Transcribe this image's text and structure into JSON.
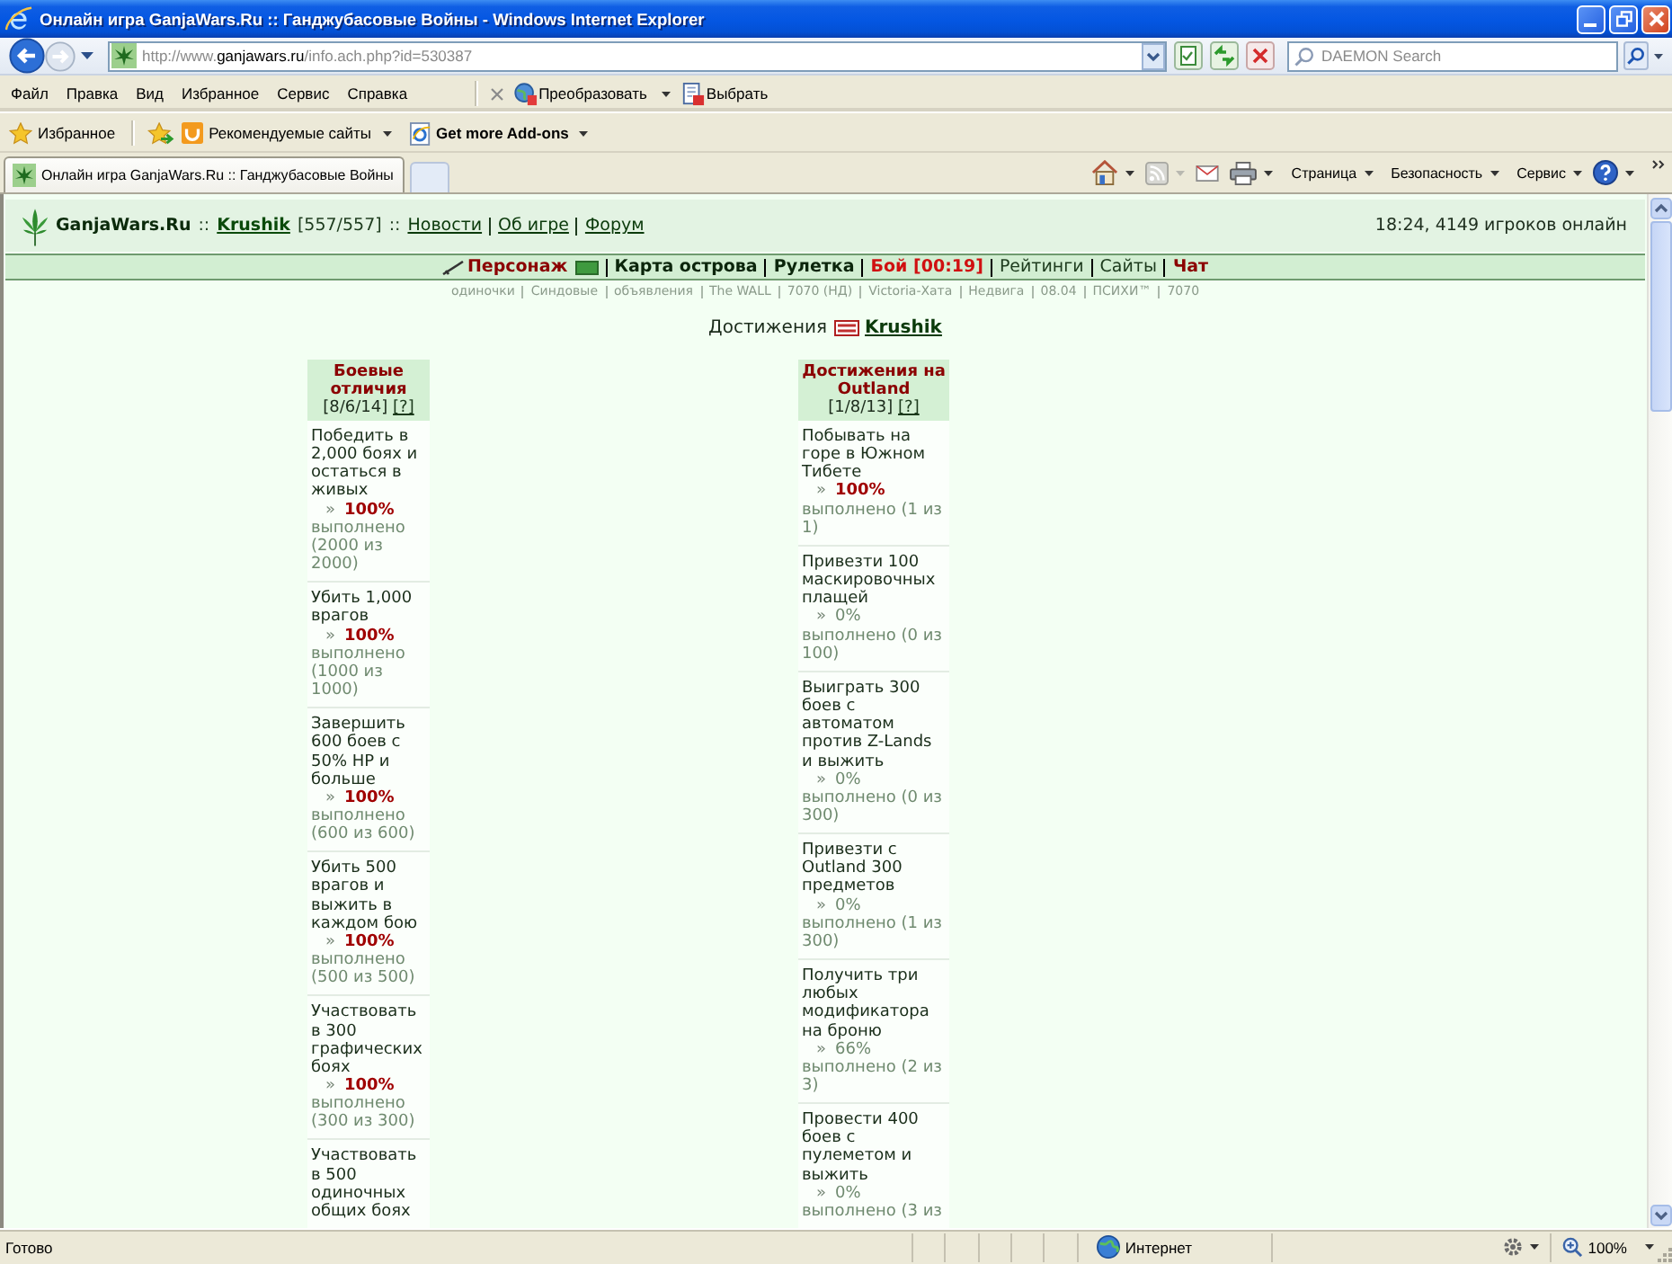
{
  "window": {
    "title": "Онлайн игра GanjaWars.Ru :: Ганджубасовые Войны - Windows Internet Explorer"
  },
  "address_bar": {
    "url": [
      {
        "text": "http://www.",
        "highlighted": false
      },
      {
        "text": "ganjawars.ru",
        "highlighted": true
      },
      {
        "text": "/info.ach.php?id=530387",
        "highlighted": false
      }
    ],
    "search_placeholder": "DAEMON Search"
  },
  "menu_bar": {
    "menus": [
      "Файл",
      "Правка",
      "Вид",
      "Избранное",
      "Сервис",
      "Справка"
    ],
    "tools": [
      {
        "label": "Преобразовать",
        "dropdown": true
      },
      {
        "label": "Выбрать",
        "dropdown": false
      }
    ]
  },
  "favorites_bar": {
    "favorites_label": "Избранное",
    "links": [
      {
        "label": "Рекомендуемые сайты",
        "bold": false
      },
      {
        "label": "Get more Add-ons",
        "bold": true
      }
    ]
  },
  "tabs": [
    {
      "label": "Онлайн игра GanjaWars.Ru :: Ганджубасовые Войны",
      "selected": true
    }
  ],
  "command_bar": [
    "Страница",
    "Безопасность",
    "Сервис"
  ],
  "page": {
    "header": {
      "segments": [
        {
          "text": "GanjaWars.Ru",
          "kind": "site"
        },
        {
          "text": "::",
          "kind": "text"
        },
        {
          "text": "Krushik",
          "kind": "user"
        },
        {
          "text": "[557/557]",
          "kind": "text"
        },
        {
          "text": "::",
          "kind": "text"
        }
      ],
      "links": [
        "Новости",
        "Об игре",
        "Форум"
      ],
      "online": "18:24, 4149 игроков онлайн"
    },
    "nav": [
      {
        "label": "Персонаж",
        "kind": "accent"
      },
      {
        "label": "Карта острова",
        "kind": "bold"
      },
      {
        "label": "Рулетка",
        "kind": "bold"
      },
      {
        "label": "Бой [00:19]",
        "kind": "alert"
      },
      {
        "label": "Рейтинги",
        "kind": "plain"
      },
      {
        "label": "Сайты",
        "kind": "plain"
      },
      {
        "label": "Чат",
        "kind": "accent"
      }
    ],
    "sublinks": [
      "одиночки",
      "Синдовые",
      "объявления",
      "The WALL",
      "7070 (НД)",
      "Victoria-Хата",
      "Недвига",
      "08.04",
      "ПСИХИ™",
      "7070"
    ],
    "heading": {
      "label": "Достижения",
      "user": "Krushik"
    },
    "columns": [
      {
        "title": "Боевые отличия",
        "counts": "[8/6/14]",
        "help": "[?]",
        "items": [
          {
            "text": "Победить в 2,000 боях и остаться в живых",
            "marker": "»",
            "percent": "100%",
            "complete": true,
            "progress": "выполнено (2000 из 2000)"
          },
          {
            "text": "Убить 1,000 врагов",
            "marker": "»",
            "percent": "100%",
            "complete": true,
            "progress": "выполнено (1000 из 1000)"
          },
          {
            "text": "Завершить 600 боев с 50% HP и больше",
            "marker": "»",
            "percent": "100%",
            "complete": true,
            "progress": "выполнено (600 из 600)"
          },
          {
            "text": "Убить 500 врагов и выжить в каждом бою",
            "marker": "»",
            "percent": "100%",
            "complete": true,
            "progress": "выполнено (500 из 500)"
          },
          {
            "text": "Участвовать в 300 графических боях",
            "marker": "»",
            "percent": "100%",
            "complete": true,
            "progress": "выполнено (300 из 300)"
          },
          {
            "text": "Участвовать в 500 одиночных общих боях"
          }
        ]
      },
      {
        "title": "Достижения на Outland",
        "counts": "[1/8/13]",
        "help": "[?]",
        "items": [
          {
            "text": "Побывать на горе в Южном Тибете",
            "marker": "»",
            "percent": "100%",
            "complete": true,
            "progress": "выполнено (1 из 1)"
          },
          {
            "text": "Привезти 100 маскировочных плащей",
            "marker": "»",
            "percent": "0%",
            "complete": false,
            "progress": "выполнено (0 из 100)"
          },
          {
            "text": "Выиграть 300 боев с автоматом против Z-Lands и выжить",
            "marker": "»",
            "percent": "0%",
            "complete": false,
            "progress": "выполнено (0 из 300)"
          },
          {
            "text": "Привезти с Outland 300 предметов",
            "marker": "»",
            "percent": "0%",
            "complete": false,
            "progress": "выполнено (1 из 300)"
          },
          {
            "text": "Получить три любых модификатора на броню",
            "marker": "»",
            "percent": "66%",
            "complete": false,
            "progress": "выполнено (2 из 3)"
          },
          {
            "text": "Провести 400 боев с пулеметом и выжить",
            "marker": "»",
            "percent": "0%",
            "complete": false,
            "progress": "выполнено (3 из"
          }
        ]
      }
    ]
  },
  "status_bar": {
    "status": "Готово",
    "zone": "Интернет",
    "zoom": "100%"
  }
}
